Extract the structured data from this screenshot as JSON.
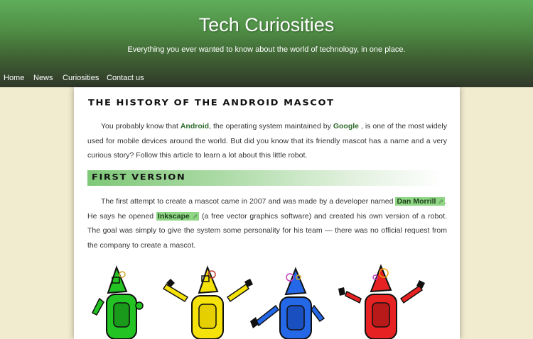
{
  "site": {
    "title": "Tech Curiosities",
    "tagline": "Everything you ever wanted to know about the world of technology, in one place."
  },
  "nav": {
    "items": [
      "Home",
      "News",
      "Curiosities",
      "Contact us"
    ]
  },
  "article": {
    "title": "The History of the Android Mascot",
    "intro": {
      "t1": "You probably know that ",
      "android": "Android",
      "t2": ", the operating system maintained by ",
      "google": "Google",
      "t3": " , is one of the most widely used for mobile devices around the world. But did you know that its friendly mascot has a name and a very curious story? Follow this article to learn a lot about this little robot."
    },
    "section1": {
      "heading": "First Version",
      "t1": "The first attempt to create a mascot came in 2007 and was made by a developer named ",
      "link1": "Dan Morrill",
      "t2": ". He says he opened ",
      "link2": "Inkscape",
      "t3": " (a free vector graphics software) and created his own version of a robot. The goal was simply to give the system some personality for his team — there was no official request from the company to create a mascot."
    },
    "link_icon": "external-link-icon",
    "robot_colors": [
      "#22c322",
      "#f4e20a",
      "#2468e8",
      "#e62222"
    ]
  },
  "colors": {
    "page_bg": "#f1ebcf",
    "header_top": "#5fae5a",
    "header_bottom": "#30382a",
    "accent_green": "#2e6a2a",
    "highlight": "#8fd685"
  }
}
